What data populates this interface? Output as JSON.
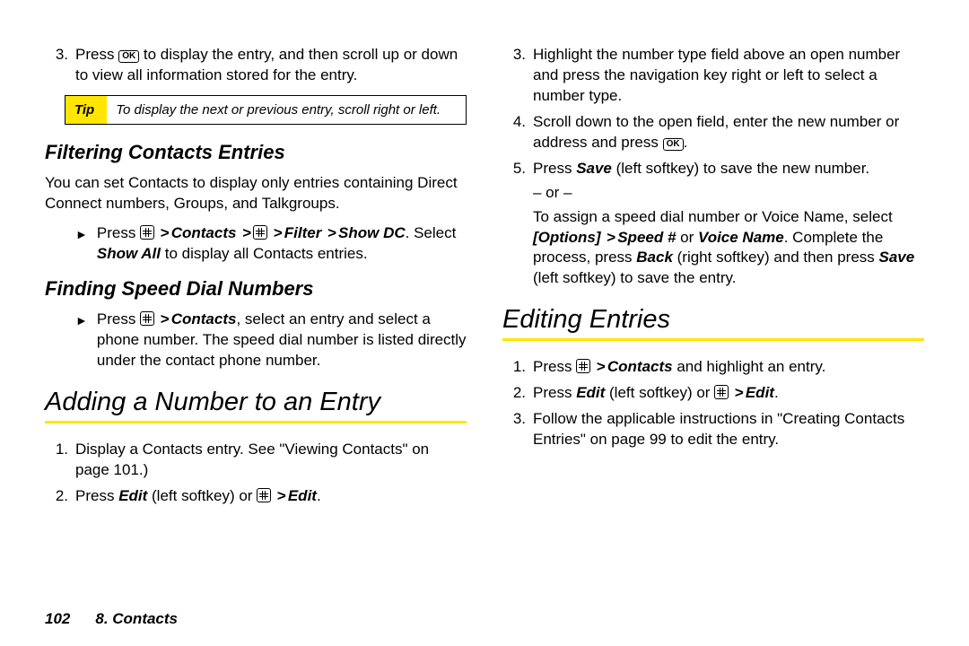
{
  "left": {
    "step3_prefix": "Press ",
    "step3_suffix": " to display the entry, and then scroll up or down to view all information stored for the entry.",
    "tipLabel": "Tip",
    "tipText": "To display the next or previous entry, scroll right or left.",
    "filterHeading": "Filtering Contacts Entries",
    "filterPara": "You can set Contacts to display only entries containing Direct Connect numbers, Groups, and Talkgroups.",
    "filterStep_a": "Press ",
    "filterStep_b": "Contacts",
    "filterStep_c": "Filter",
    "filterStep_d": "Show DC",
    "filterStep_e": ". Select ",
    "filterStep_f": "Show All",
    "filterStep_g": " to display all Contacts entries.",
    "speedHeading": "Finding Speed Dial Numbers",
    "speedStep_a": "Press ",
    "speedStep_b": "Contacts",
    "speedStep_c": ", select an entry and select a phone number. The speed dial number is listed directly under the contact phone number.",
    "addHeading": "Adding a Number to an Entry",
    "addStep1": "Display a Contacts entry. See \"Viewing Contacts\" on page 101.)",
    "addStep2_a": "Press ",
    "addStep2_b": "Edit",
    "addStep2_c": " (left softkey) or ",
    "addStep2_d": "Edit"
  },
  "right": {
    "step3": "Highlight the number type field above an open number and press the navigation key right or left to select a number type.",
    "step4_a": "Scroll down to the open field, enter the new number or address and press ",
    "step5_a": "Press ",
    "step5_b": "Save",
    "step5_c": " (left softkey) to save the new number.",
    "or": "– or –",
    "step5_d1": "To assign a speed dial number or Voice Name, select ",
    "step5_d2": "[Options]",
    "step5_d3": "Speed #",
    "step5_d4": " or ",
    "step5_d5": "Voice Name",
    "step5_d6": ". Complete the process, press ",
    "step5_d7": "Back",
    "step5_d8": " (right softkey) and then press ",
    "step5_d9": "Save",
    "step5_d10": " (left softkey) to save the entry.",
    "editHeading": "Editing Entries",
    "editStep1_a": "Press ",
    "editStep1_b": "Contacts",
    "editStep1_c": " and highlight an entry.",
    "editStep2_a": "Press ",
    "editStep2_b": "Edit",
    "editStep2_c": " (left softkey) or ",
    "editStep2_d": "Edit",
    "editStep3": "Follow the applicable instructions in \"Creating Contacts Entries\" on page 99 to edit the entry."
  },
  "footer": {
    "pageNum": "102",
    "chapter": "8. Contacts"
  },
  "icons": {
    "ok": "OK"
  }
}
